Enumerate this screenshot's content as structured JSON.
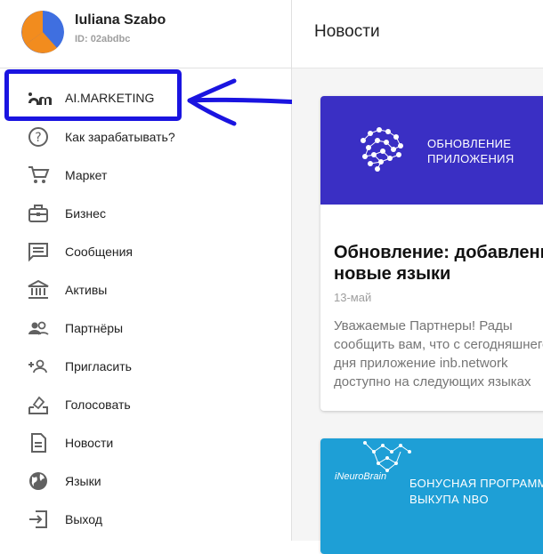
{
  "user": {
    "name": "Iuliana Szabo",
    "id": "ID: 02abdbc"
  },
  "header": {
    "title": "Новости"
  },
  "menu": [
    {
      "label": "AI.MARKETING",
      "icon": "ai-marketing-logo-icon"
    },
    {
      "label": "Как зарабатывать?",
      "icon": "help-circle-icon"
    },
    {
      "label": "Маркет",
      "icon": "shopping-cart-icon"
    },
    {
      "label": "Бизнес",
      "icon": "briefcase-icon"
    },
    {
      "label": "Сообщения",
      "icon": "message-icon"
    },
    {
      "label": "Активы",
      "icon": "bank-icon"
    },
    {
      "label": "Партнёры",
      "icon": "people-icon"
    },
    {
      "label": "Пригласить",
      "icon": "person-add-icon"
    },
    {
      "label": "Голосовать",
      "icon": "ballot-icon"
    },
    {
      "label": "Новости",
      "icon": "article-icon"
    },
    {
      "label": "Языки",
      "icon": "globe-icon"
    },
    {
      "label": "Выход",
      "icon": "exit-icon"
    }
  ],
  "news": [
    {
      "banner_text": "ОБНОВЛЕНИЕ\nПРИЛОЖЕНИЯ",
      "title": "Обновление: добавлены\nновые языки",
      "date": "13-май",
      "excerpt": "Уважаемые Партнеры! Рады\nсообщить вам, что с сегодняшнего\nдня приложение inb.network\nдоступно на следующих языках"
    },
    {
      "brand": "iNeuroBrain",
      "banner_text": "БОНУСНАЯ ПРОГРАММА\nВЫКУПА NBO"
    }
  ],
  "colors": {
    "highlight": "#1a14e0",
    "banner1": "#3a2fc4",
    "banner2": "#1e9fd6",
    "avatar_orange": "#f28c1e",
    "avatar_blue": "#3f6fe0"
  }
}
